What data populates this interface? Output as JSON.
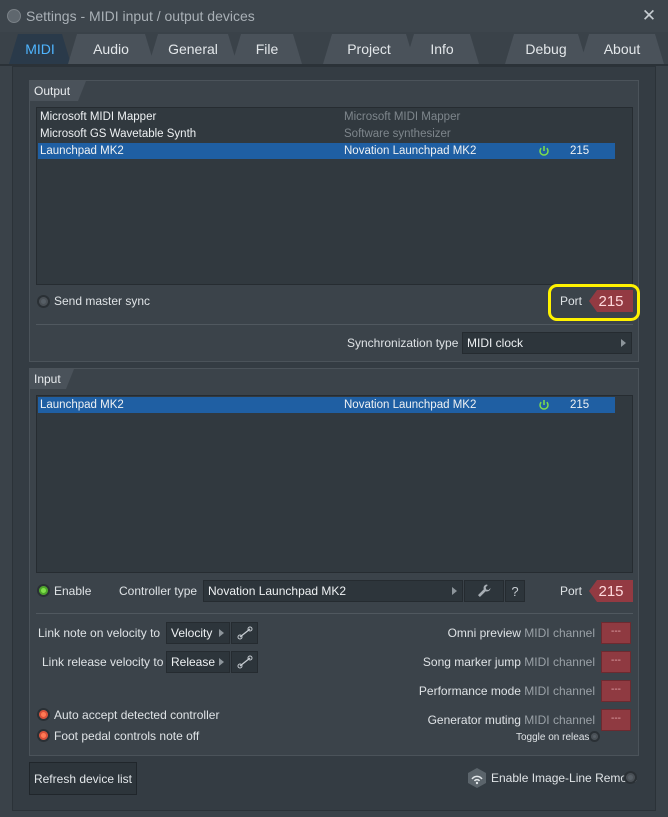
{
  "window": {
    "title": "Settings - MIDI input / output devices",
    "close_glyph": "✕"
  },
  "tabs": [
    "MIDI",
    "Audio",
    "General",
    "File",
    "Project",
    "Info",
    "Debug",
    "About"
  ],
  "output": {
    "title": "Output",
    "devices": [
      {
        "name": "Microsoft MIDI Mapper",
        "driver": "Microsoft MIDI Mapper",
        "port": "",
        "selected": false
      },
      {
        "name": "Microsoft GS Wavetable Synth",
        "driver": "Software synthesizer",
        "port": "",
        "selected": false
      },
      {
        "name": "Launchpad MK2",
        "driver": "Novation Launchpad MK2",
        "port": "215",
        "selected": true
      }
    ],
    "send_master_sync_label": "Send master sync",
    "port_label": "Port",
    "port_value": "215",
    "sync_type_label": "Synchronization type",
    "sync_type_value": "MIDI clock"
  },
  "input": {
    "title": "Input",
    "devices": [
      {
        "name": "Launchpad MK2",
        "driver": "Novation Launchpad MK2",
        "port": "215",
        "selected": true
      }
    ],
    "enable_label": "Enable",
    "controller_type_label": "Controller type",
    "controller_type_value": "Novation Launchpad MK2",
    "help_glyph": "?",
    "port_label": "Port",
    "port_value": "215",
    "link_note_label": "Link note on velocity to",
    "link_note_value": "Velocity",
    "link_release_label": "Link release velocity to",
    "link_release_value": "Release",
    "auto_accept_label": "Auto accept detected controller",
    "foot_pedal_label": "Foot pedal controls note off",
    "midi_channels": [
      {
        "label": "Omni preview",
        "suffix": "MIDI channel",
        "value": "---"
      },
      {
        "label": "Song marker jump",
        "suffix": "MIDI channel",
        "value": "---"
      },
      {
        "label": "Performance mode",
        "suffix": "MIDI channel",
        "value": "---"
      },
      {
        "label": "Generator muting",
        "suffix": "MIDI channel",
        "value": "---"
      }
    ],
    "toggle_on_release_label": "Toggle on release"
  },
  "footer": {
    "refresh_label": "Refresh device list",
    "remote_label": "Enable Image-Line Remote"
  },
  "colors": {
    "accent": "#4fb5ff",
    "selection": "#1f5fa3",
    "port_box": "#933a42",
    "highlight": "#fff200"
  }
}
